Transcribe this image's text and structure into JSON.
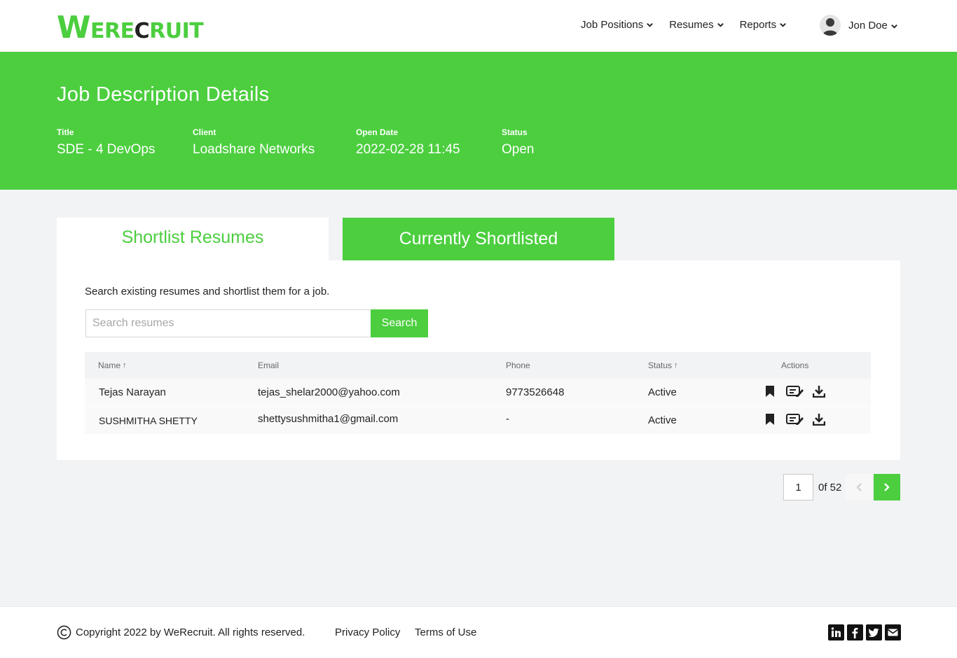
{
  "brand": {
    "logo_w": "W",
    "logo_rest": "ERE",
    "logo_c": "C",
    "logo_end": "RUIT"
  },
  "nav": {
    "items": [
      {
        "label": "Job Positions"
      },
      {
        "label": "Resumes"
      },
      {
        "label": "Reports"
      }
    ],
    "user_name": "Jon Doe"
  },
  "hero": {
    "title": "Job Description Details",
    "fields": [
      {
        "label": "Title",
        "value": "SDE - 4 DevOps"
      },
      {
        "label": "Client",
        "value": "Loadshare Networks"
      },
      {
        "label": "Open Date",
        "value": "2022-02-28 11:45"
      },
      {
        "label": "Status",
        "value": "Open"
      }
    ]
  },
  "tabs": [
    {
      "label": "Shortlist Resumes"
    },
    {
      "label": "Currently Shortlisted"
    }
  ],
  "panel": {
    "description": "Search existing resumes and shortlist them for a job.",
    "search_placeholder": "Search resumes",
    "search_value": "",
    "search_button": "Search"
  },
  "table": {
    "columns": [
      {
        "label": "Name",
        "sortable": true
      },
      {
        "label": "Email",
        "sortable": false
      },
      {
        "label": "Phone",
        "sortable": false
      },
      {
        "label": "Status",
        "sortable": true
      },
      {
        "label": "Actions",
        "sortable": false
      }
    ],
    "sort_arrow": "↑",
    "rows": [
      {
        "name": "Tejas Narayan",
        "email": "tejas_shelar2000@yahoo.com",
        "phone": "9773526648",
        "status": "Active"
      },
      {
        "name": "SUSHMITHA SHETTY",
        "email": "shettysushmitha1@gmail.com",
        "phone": "-",
        "status": "Active"
      }
    ]
  },
  "pagination": {
    "current": "1",
    "of_text": "0f 52"
  },
  "footer": {
    "copyright": "Copyright 2022 by WeRecruit. All rights reserved.",
    "privacy": "Privacy Policy",
    "terms": "Terms of Use",
    "social_icons": [
      "linkedin-icon",
      "facebook-icon",
      "twitter-icon",
      "mail-icon"
    ]
  },
  "colors": {
    "accent": "#4cce3f",
    "text": "#222222",
    "background": "#f2f3f5"
  }
}
